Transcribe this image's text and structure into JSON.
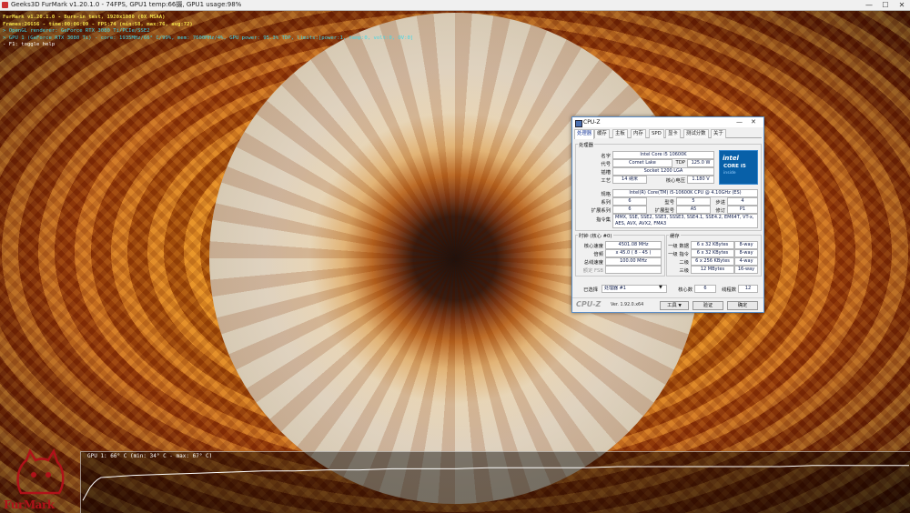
{
  "furmark": {
    "window_title": "Geeks3D FurMark v1.20.1.0 - 74FPS, GPU1 temp:66摄, GPU1 usage:98%",
    "overlay": {
      "line1": "FurMark v1.20.1.0 - Burn-in test, 1920x1080 (0X MSAA)",
      "line2": "Frames:26656 - time:00:06:09 - FPS:74 (min:58, max:76, avg:72)",
      "line3": "> OpenGL renderer: GeForce RTX 3080 Ti/PCIe/SSE2",
      "line4": "> GPU 1 (GeForce RTX 3080 Ti) - core: 1935MHz/66° C/99%, mem: 7600MHz/4%, GPU power: 95.3% TDP, limits:[power:1, temp:0, volt:0, OV:0]",
      "line5": "- F1: toggle help"
    },
    "graph_label": "GPU 1: 66° C (min: 34° C - max: 67° C)",
    "graph_series": [
      34,
      40,
      46,
      50,
      53,
      55,
      57,
      58,
      59,
      60,
      61,
      61,
      62,
      62,
      63,
      63,
      63,
      64,
      64,
      64,
      64,
      65,
      65,
      65,
      65,
      65,
      65,
      66,
      66,
      66,
      66
    ],
    "logo_text": "FurMark"
  },
  "cpuz": {
    "title": "CPU-Z",
    "tabs": [
      "处理器",
      "缓存",
      "主板",
      "内存",
      "SPD",
      "显卡",
      "测试分数",
      "关于"
    ],
    "processor_group": "处理器",
    "name_label": "名字",
    "name_value": "Intel Core i5 10600K",
    "codename_label": "代号",
    "codename_value": "Comet Lake",
    "tdp_label": "TDP",
    "tdp_value": "125.0 W",
    "socket_label": "插槽",
    "socket_value": "Socket 1200 LGA",
    "tech_label": "工艺",
    "tech_value": "14 纳米",
    "voltage_label": "核心电压",
    "voltage_value": "1.180 V",
    "spec_label": "规格",
    "spec_value": "Intel(R) Core(TM) i5-10600K CPU @ 4.10GHz (ES)",
    "family_label": "系列",
    "family_value": "6",
    "model_label": "型号",
    "model_value": "5",
    "stepping_label": "步进",
    "stepping_value": "4",
    "ext_family_label": "扩展系列",
    "ext_family_value": "6",
    "ext_model_label": "扩展型号",
    "ext_model_value": "A5",
    "revision_label": "修订",
    "revision_value": "P1",
    "instr_label": "指令集",
    "instr_value": "MMX, SSE, SSE2, SSE3, SSSE3, SSE4.1, SSE4.2, EM64T, VT-x, AES, AVX, AVX2, FMA3",
    "intel_logo": {
      "brand": "intel",
      "line1": "CORE i5",
      "line2": "inside"
    },
    "clocks_group": "时钟 (核心 #0)",
    "core_speed_label": "核心速度",
    "core_speed_value": "4501.08 MHz",
    "multiplier_label": "倍频",
    "multiplier_value": "x 45.0 ( 8 - 45 )",
    "bus_label": "总线速度",
    "bus_value": "100.00 MHz",
    "fsb_label": "额定 FSB",
    "fsb_value": "",
    "cache_group": "缓存",
    "l1d_label": "一级 数据",
    "l1d_value": "6 x 32 KBytes",
    "l1d_way": "8-way",
    "l1i_label": "一级 指令",
    "l1i_value": "6 x 32 KBytes",
    "l1i_way": "8-way",
    "l2_label": "二级",
    "l2_value": "6 x 256 KBytes",
    "l2_way": "4-way",
    "l3_label": "三级",
    "l3_value": "12 MBytes",
    "l3_way": "16-way",
    "selected_label": "已选择",
    "selected_value": "处理器 #1",
    "cores_label": "核心数",
    "cores_value": "6",
    "threads_label": "线程数",
    "threads_value": "12",
    "brand": "CPU-Z",
    "version": "Ver. 1.92.0.x64",
    "tools_button": "工具",
    "validate_button": "验证",
    "ok_button": "确定"
  }
}
